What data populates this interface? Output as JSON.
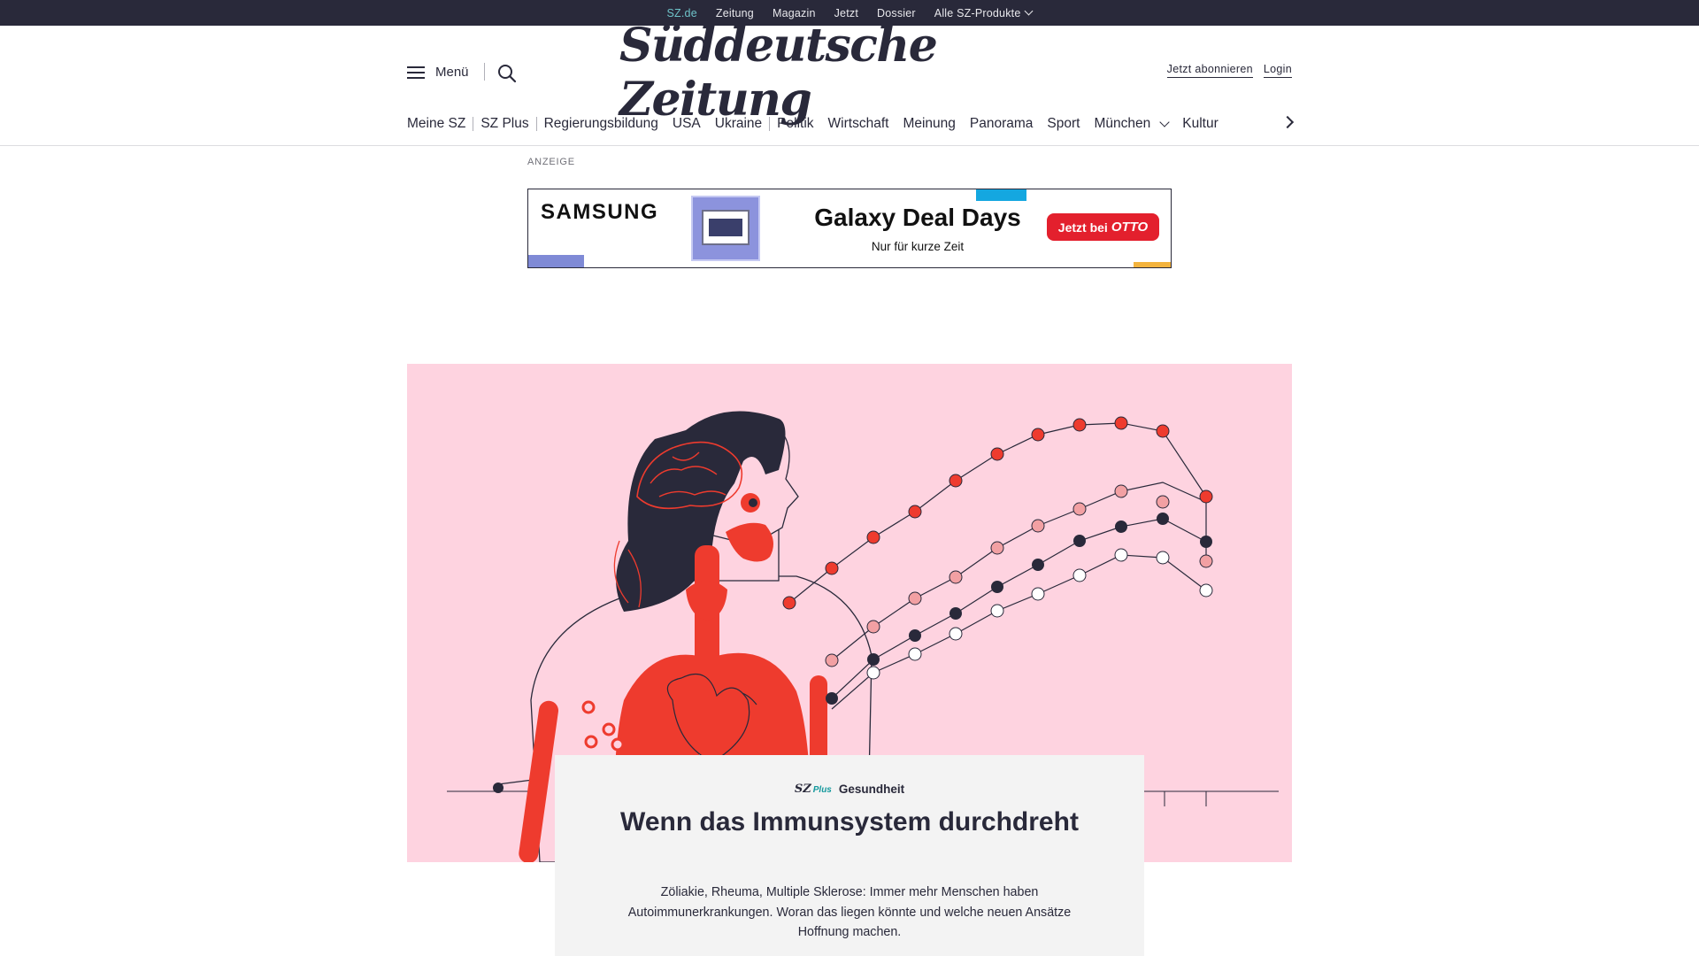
{
  "top_bar": {
    "links": [
      {
        "label": "SZ.de",
        "active": true
      },
      {
        "label": "Zeitung"
      },
      {
        "label": "Magazin"
      },
      {
        "label": "Jetzt"
      },
      {
        "label": "Dossier"
      },
      {
        "label": "Alle SZ-Produkte",
        "has_dropdown": true
      }
    ]
  },
  "header": {
    "menu_label": "Menü",
    "logo_text": "Süddeutsche Zeitung",
    "subscribe_label": "Jetzt abonnieren",
    "login_label": "Login"
  },
  "nav": {
    "items": [
      {
        "label": "Meine SZ"
      },
      {
        "label": "SZ Plus"
      },
      {
        "label": "Regierungsbildung"
      },
      {
        "label": "USA"
      },
      {
        "label": "Ukraine"
      },
      {
        "label": "Politik"
      },
      {
        "label": "Wirtschaft"
      },
      {
        "label": "Meinung"
      },
      {
        "label": "Panorama"
      },
      {
        "label": "Sport"
      },
      {
        "label": "München",
        "has_dropdown": true
      },
      {
        "label": "Kultur"
      }
    ]
  },
  "ad": {
    "label": "ANZEIGE",
    "brand": "SAMSUNG",
    "headline": "Galaxy Deal Days",
    "subline": "Nur für kurze Zeit",
    "cta_prefix": "Jetzt bei",
    "cta_brand": "OTTO"
  },
  "article": {
    "section_badge_sz": "SZ",
    "section_badge_plus": "Plus",
    "section": "Gesundheit",
    "title": "Wenn das Immunsystem durchdreht",
    "teaser": "Zöliakie, Rheuma, Multiple Sklerose: Immer mehr Menschen haben Autoimmunerkrankungen. Woran das liegen könnte und welche neuen Ansätze Hoffnung machen."
  },
  "colors": {
    "dark": "#29293a",
    "accent_teal": "#6ec3c9",
    "hero_background": "#fed3e0",
    "illustration_red": "#ee3b2e",
    "card_background": "#f3f3f3"
  }
}
